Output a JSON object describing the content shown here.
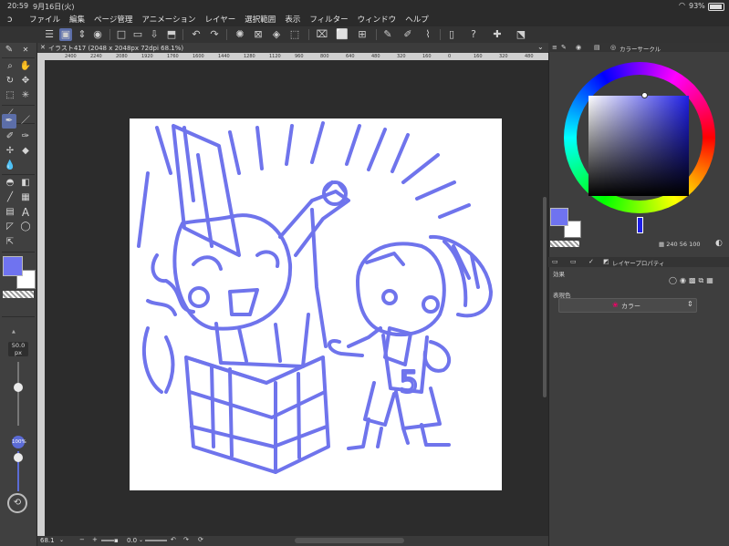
{
  "status": {
    "time": "20:59",
    "date": "9月16日(火)",
    "battery": "93%"
  },
  "menu": [
    "ファイル",
    "編集",
    "ページ管理",
    "アニメーション",
    "レイヤー",
    "選択範囲",
    "表示",
    "フィルター",
    "ウィンドウ",
    "ヘルプ"
  ],
  "canvas_tab": {
    "title": "イラスト417 (2048 x 2048px 72dpi 68.1%)"
  },
  "ruler_ticks": [
    "2400",
    "2240",
    "2080",
    "1920",
    "1760",
    "1600",
    "1440",
    "1280",
    "1120",
    "960",
    "800",
    "640",
    "480",
    "320",
    "160",
    "0",
    "160",
    "320",
    "480",
    "640"
  ],
  "brush": {
    "size": "50.0",
    "unit": "px",
    "opacity": "100",
    "opacity_unit": "%"
  },
  "bottom_status": {
    "zoom": "68.1",
    "angle": "0.0"
  },
  "colors": {
    "main": "#6f73f0",
    "sub": "#ffffff",
    "stroke": "#6f74ec",
    "sv_hue": "#1f1fe6"
  },
  "color_panel": {
    "title": "カラーサークル",
    "readout": "240",
    "s": "56",
    "v": "100"
  },
  "layer_panel": {
    "title": "レイヤープロパティ",
    "effect_label": "効果",
    "expression_label": "表現色",
    "expression_value": "カラー"
  }
}
